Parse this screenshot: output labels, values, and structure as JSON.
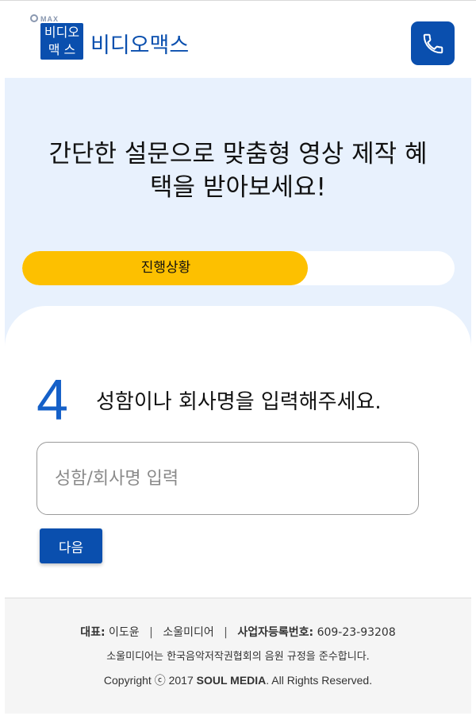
{
  "header": {
    "logo_max": "MAX",
    "logo_box_line1": "비디오",
    "logo_box_line2": "맥 스",
    "brand_name": "비디오맥스",
    "phone_icon": "phone-icon"
  },
  "hero": {
    "title": "간단한 설문으로 맞춤형 영상 제작 혜택을 받아보세요!",
    "progress_label": "진행상황",
    "progress_value": 0.66
  },
  "survey": {
    "step_number": "4",
    "question": "성함이나 회사명을 입력해주세요.",
    "input_placeholder": "성함/회사명 입력",
    "input_value": "",
    "next_label": "다음"
  },
  "footer": {
    "ceo_label": "대표:",
    "ceo_name": "이도윤",
    "company": "소울미디어",
    "biz_label": "사업자등록번호:",
    "biz_number": "609-23-93208",
    "compliance": "소울미디어는 한국음악저작권협회의 음원 규정을 준수합니다.",
    "copyright_prefix": "Copyright ⓒ 2017",
    "copyright_brand": "SOUL MEDIA",
    "copyright_suffix": ". All Rights Reserved."
  },
  "colors": {
    "brand_blue": "#0a4fae",
    "step_blue": "#1560c8",
    "progress_yellow": "#fdc000",
    "hero_bg": "#e8f1fd"
  }
}
